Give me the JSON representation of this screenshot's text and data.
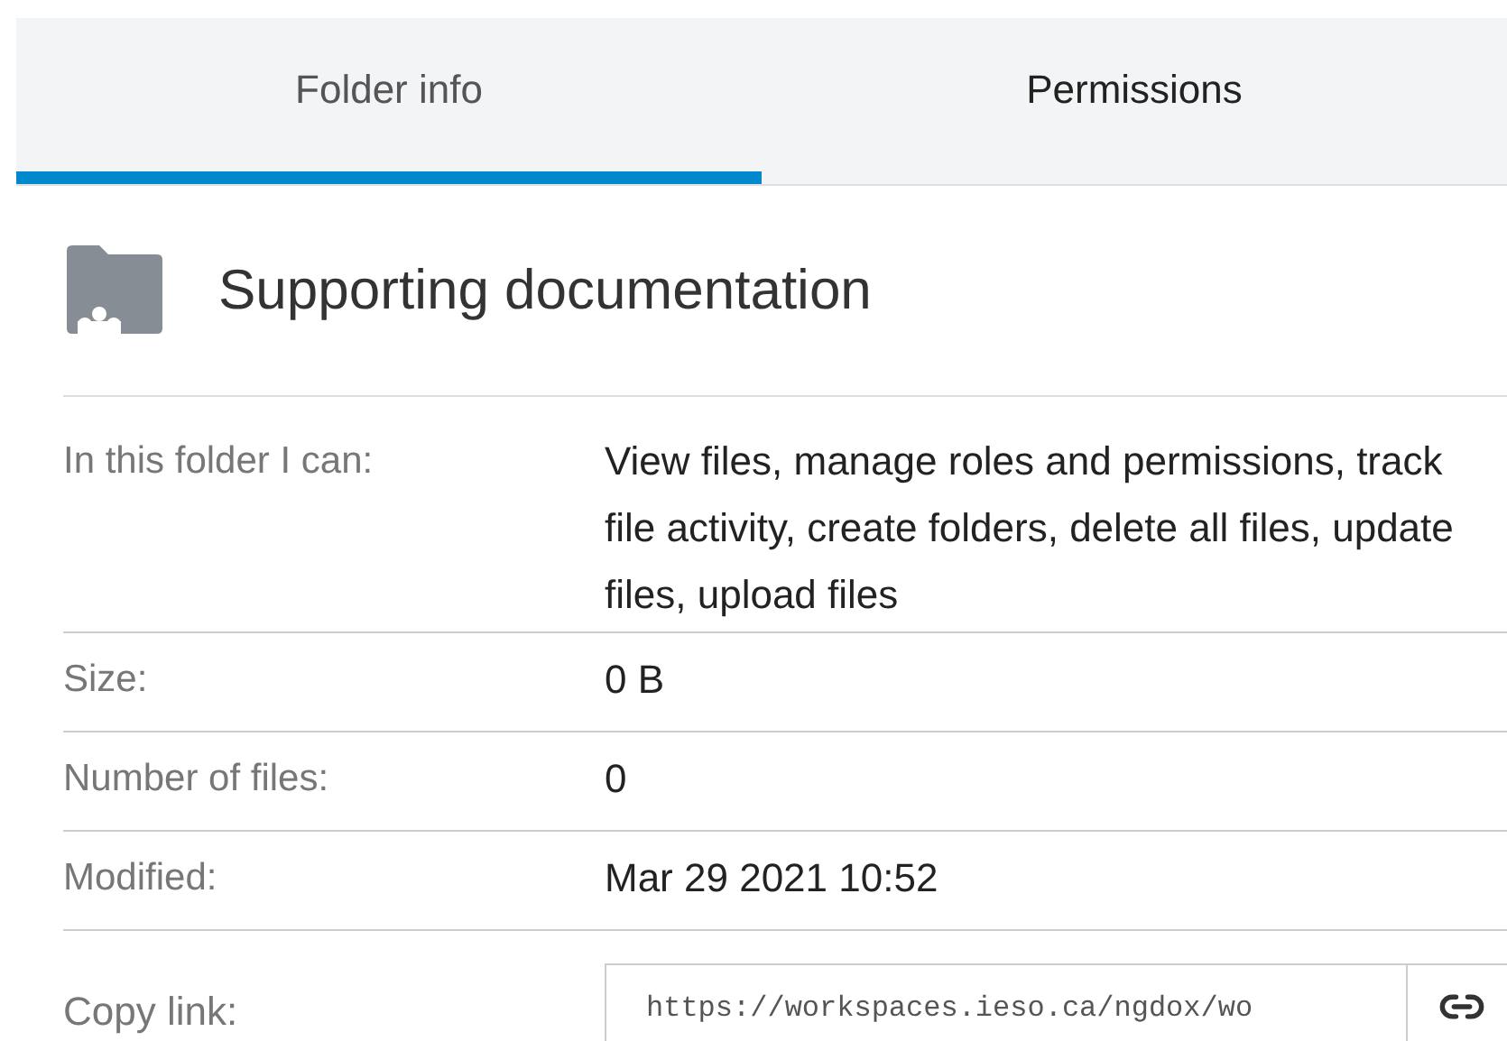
{
  "tabs": [
    {
      "label": "Folder info",
      "selected": true
    },
    {
      "label": "Permissions",
      "selected": false
    }
  ],
  "folder": {
    "name": "Supporting documentation"
  },
  "details": [
    {
      "label": "In this folder I can:",
      "value": "View files, manage roles and permissions, track file activity, create folders, delete all files, update files, upload files"
    },
    {
      "label": "Size:",
      "value": "0 B"
    },
    {
      "label": "Number of files:",
      "value": "0"
    },
    {
      "label": "Modified:",
      "value": "Mar 29 2021 10:52"
    }
  ],
  "copy_link": {
    "label": "Copy link:",
    "value": "https://workspaces.ieso.ca/ngdox/wo"
  }
}
